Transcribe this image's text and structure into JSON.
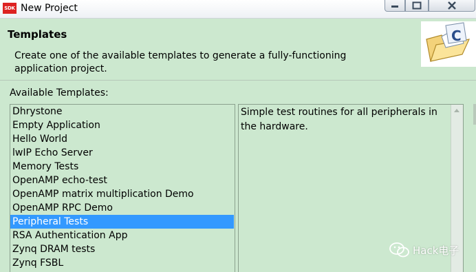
{
  "window": {
    "icon_text": "SDK",
    "title": "New Project"
  },
  "header": {
    "title": "Templates",
    "description": "Create one of the available templates to generate a fully-functioning application project.",
    "image_icon": "folder-c-icon"
  },
  "available_label": "Available Templates:",
  "templates": [
    "Dhrystone",
    "Empty Application",
    "Hello World",
    "lwIP Echo Server",
    "Memory Tests",
    "OpenAMP echo-test",
    "OpenAMP matrix multiplication Demo",
    "OpenAMP RPC Demo",
    "Peripheral Tests",
    "RSA Authentication App",
    "Zynq DRAM tests",
    "Zynq FSBL"
  ],
  "selected_template": "Peripheral Tests",
  "description_panel": {
    "text": "Simple test routines for all peripherals in the hardware."
  },
  "watermark": {
    "text": "Hack电子",
    "icon": "wechat-icon"
  },
  "colors": {
    "background": "#cce8cf",
    "selection": "#3399ff"
  }
}
